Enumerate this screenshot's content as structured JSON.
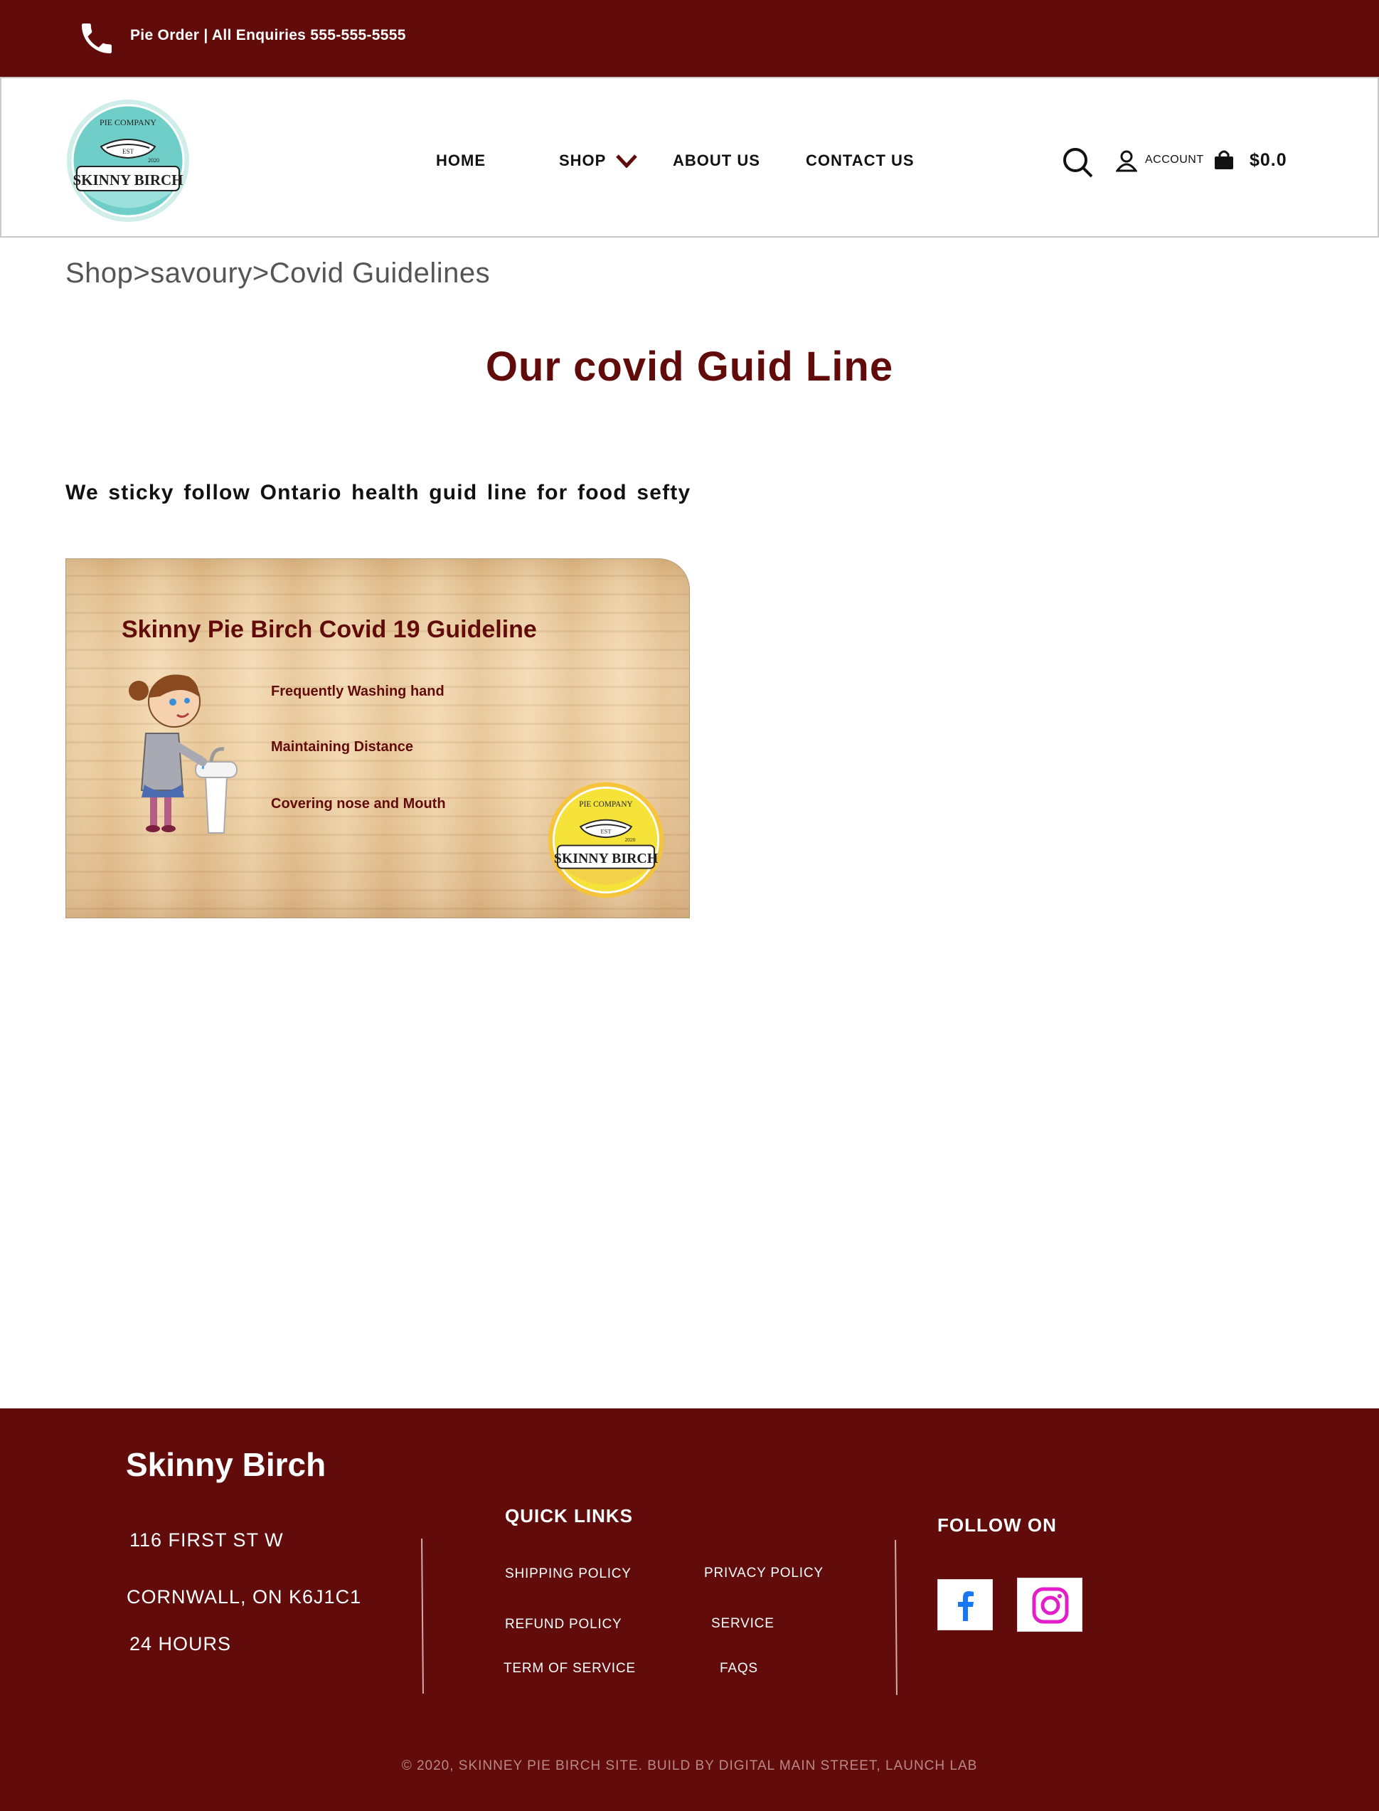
{
  "topbar": {
    "phone_icon": "phone-icon",
    "text": "Pie Order | All Enquiries  555-555-5555"
  },
  "logo": {
    "top_text": "PIE COMPANY",
    "est": "EST",
    "year": "2020",
    "name": "SKINNY BIRCH"
  },
  "nav": {
    "items": [
      {
        "label": "HOME"
      },
      {
        "label": "SHOP"
      },
      {
        "label": "ABOUT US"
      },
      {
        "label": "CONTACT US"
      }
    ],
    "account_label": "ACCOUNT",
    "cart_total": "$0.0"
  },
  "breadcrumb": "Shop>savoury>Covid  Guidelines",
  "page_title": "Our covid Guid Line",
  "intro": "We sticky follow Ontario health guid line for food sefty",
  "card": {
    "title": "Skinny Pie Birch Covid 19 Guideline",
    "items": [
      "Frequently Washing hand",
      "Maintaining Distance",
      "Covering nose and Mouth"
    ]
  },
  "footer": {
    "brand": "Skinny Birch",
    "address_line1": "116 FIRST ST W",
    "address_line2": "CORNWALL, ON K6J1C1",
    "hours": "24 HOURS",
    "quick_links_heading": "QUICK LINKS",
    "quick_links": [
      "SHIPPING POLICY",
      "PRIVACY POLICY",
      "REFUND POLICY",
      "SERVICE",
      "TERM OF SERVICE",
      "FAQS"
    ],
    "follow_heading": "FOLLOW ON",
    "socials": [
      "facebook-icon",
      "instagram-icon"
    ],
    "copyright": "© 2020, SKINNEY PIE BIRCH SITE. BUILD BY DIGITAL MAIN STREET, LAUNCH LAB"
  },
  "colors": {
    "brand_maroon": "#620b0b",
    "logo_teal": "#6fcfc8",
    "logo_yellow": "#f5d23a",
    "facebook_blue": "#1877f2",
    "instagram_pink": "#e21ec8"
  }
}
